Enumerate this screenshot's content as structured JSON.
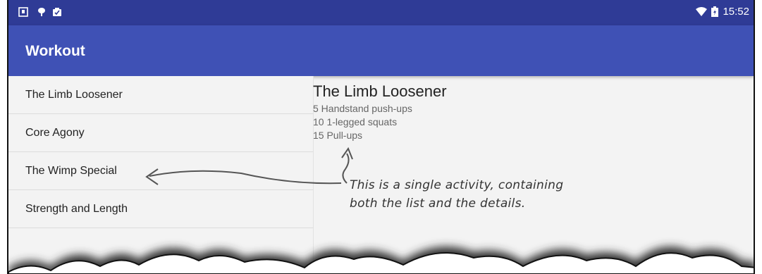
{
  "status_bar": {
    "time": "15:52",
    "left_icons": [
      "sd-card-icon",
      "android-debug-icon",
      "clipboard-icon"
    ],
    "right_icons": [
      "wifi-icon",
      "battery-icon"
    ],
    "color": "#2f3b96"
  },
  "app_bar": {
    "title": "Workout",
    "color": "#3f51b5"
  },
  "workouts": [
    {
      "label": "The Limb Loosener"
    },
    {
      "label": "Core Agony"
    },
    {
      "label": "The Wimp Special"
    },
    {
      "label": "Strength and Length"
    }
  ],
  "detail": {
    "title": "The Limb Loosener",
    "lines": [
      "5 Handstand push-ups",
      "10 1-legged squats",
      "15 Pull-ups"
    ]
  },
  "annotation": {
    "line1": "This is a single activity, containing",
    "line2": "both the list and the details."
  }
}
